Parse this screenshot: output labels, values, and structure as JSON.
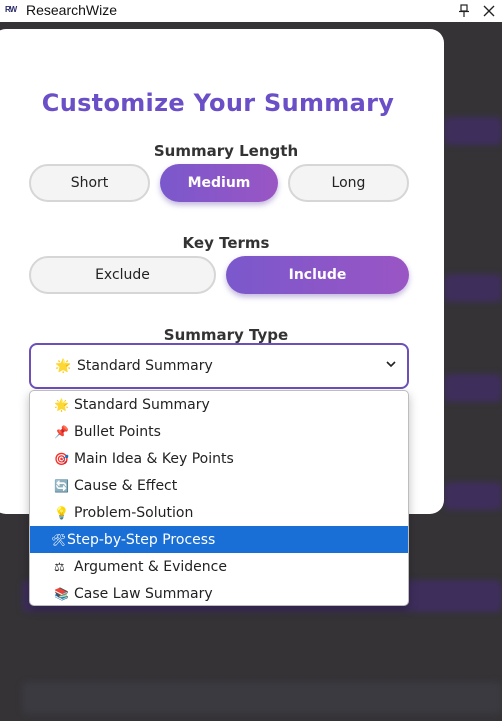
{
  "app": {
    "title": "ResearchWize",
    "logo_text": "RW",
    "pin_glyph": "⊥",
    "close_glyph": "✕"
  },
  "modal": {
    "title": "Customize Your Summary",
    "length": {
      "label": "Summary Length",
      "options": [
        "Short",
        "Medium",
        "Long"
      ],
      "selected": "Medium"
    },
    "key_terms": {
      "label": "Key Terms",
      "options": [
        "Exclude",
        "Include"
      ],
      "selected": "Include"
    },
    "type": {
      "label": "Summary Type",
      "selected_label": "Standard Summary",
      "selected_icon": "🌟",
      "options": [
        {
          "icon": "🌟",
          "label": "Standard Summary"
        },
        {
          "icon": "📌",
          "label": "Bullet Points"
        },
        {
          "icon": "🎯",
          "label": "Main Idea & Key Points"
        },
        {
          "icon": "🔄",
          "label": "Cause & Effect"
        },
        {
          "icon": "💡",
          "label": "Problem-Solution"
        },
        {
          "icon": "🛠",
          "label": "Step-by-Step Process"
        },
        {
          "icon": "⚖",
          "label": "Argument & Evidence"
        },
        {
          "icon": "📚",
          "label": "Case Law Summary"
        }
      ],
      "highlighted": "Step-by-Step Process"
    }
  },
  "colors": {
    "accent": "#6a4fc7",
    "pill_gradient_start": "#7a58cc",
    "pill_gradient_end": "#9a55c4",
    "highlight": "#1a6fd6",
    "backdrop": "#353336"
  }
}
